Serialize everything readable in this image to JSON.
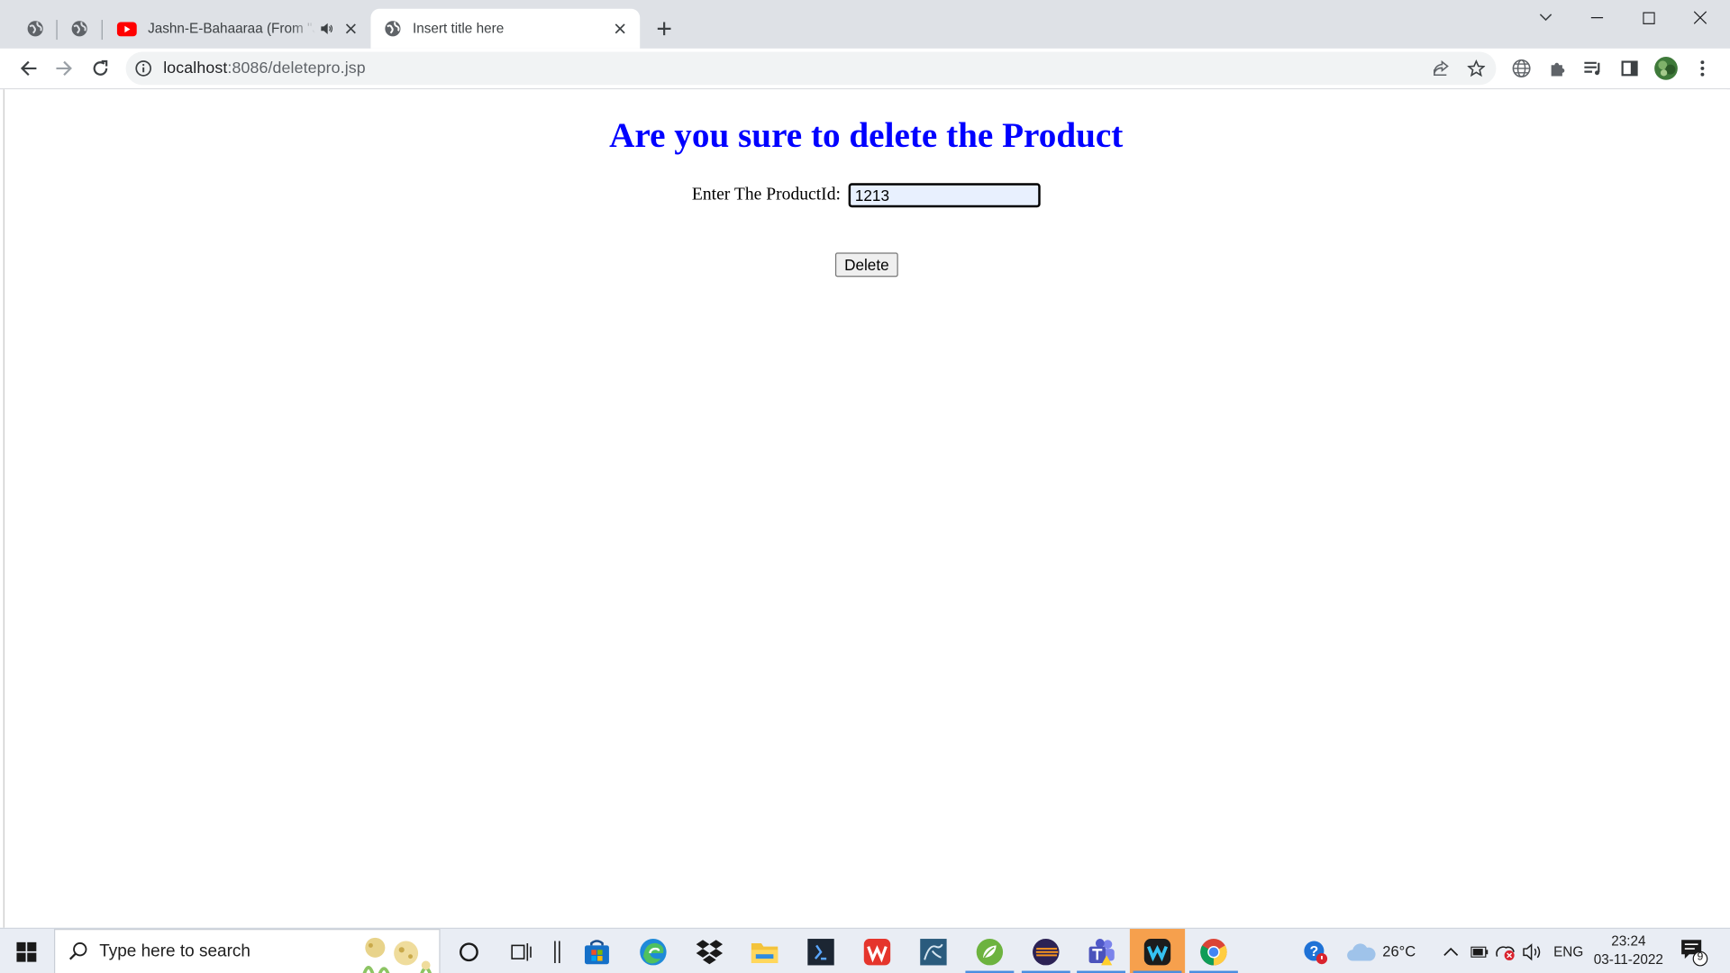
{
  "browser": {
    "tabs": [
      {
        "title": "Jashn-E-Bahaaraa (From \"Jodhaa Akbar\")",
        "muted_icon": "speaker-icon"
      },
      {
        "title": "Insert title here"
      }
    ],
    "address": {
      "host": "localhost",
      "path": ":8086/deletepro.jsp"
    }
  },
  "page": {
    "heading": "Are you sure to delete the Product",
    "form": {
      "label": "Enter The ProductId:",
      "product_id_value": "1213",
      "delete_label": "Delete"
    }
  },
  "taskbar": {
    "search_placeholder": "Type here to search",
    "weather_temp": "26°C",
    "language": "ENG",
    "time": "23:24",
    "date": "03-11-2022",
    "notification_count": "9"
  },
  "colors": {
    "heading": "#0000ff",
    "tabstrip": "#dee1e6",
    "taskbar": "#e9edf4"
  }
}
